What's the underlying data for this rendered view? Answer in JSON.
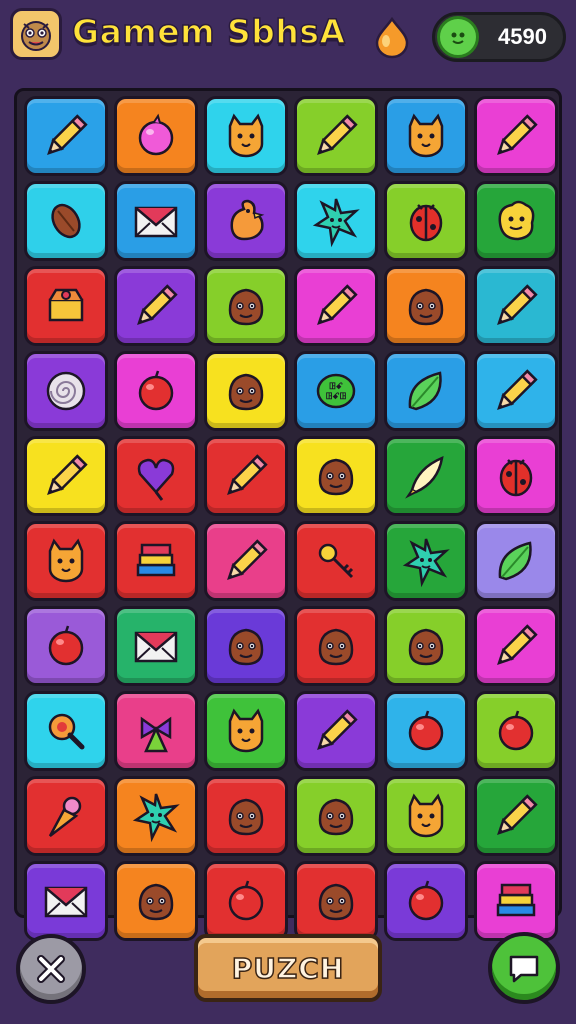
{
  "header": {
    "title": "Gamem SbhsA",
    "coins": "4590"
  },
  "colors": {
    "background": "#3f2c5e",
    "title": "#ffe23a",
    "accent_green": "#4ec23a"
  },
  "board": {
    "rows": [
      [
        {
          "color": "#2aa1e8",
          "icon": "pencil-icon"
        },
        {
          "color": "#f5841f",
          "icon": "bubble-icon"
        },
        {
          "color": "#2fd3ec",
          "icon": "cat-icon"
        },
        {
          "color": "#86cf2a",
          "icon": "pencil-icon"
        },
        {
          "color": "#2a9ee6",
          "icon": "cat-icon"
        },
        {
          "color": "#ea3fd4",
          "icon": "pencil-icon"
        }
      ],
      [
        {
          "color": "#2fd0ea",
          "icon": "nut-icon"
        },
        {
          "color": "#2a9ee6",
          "icon": "envelope-icon"
        },
        {
          "color": "#8a3ad8",
          "icon": "duck-icon"
        },
        {
          "color": "#2fd3ec",
          "icon": "star-icon"
        },
        {
          "color": "#86cf2a",
          "icon": "bug-icon"
        },
        {
          "color": "#26a63a",
          "icon": "blob-icon"
        }
      ],
      [
        {
          "color": "#e23030",
          "icon": "box-icon"
        },
        {
          "color": "#8a3ad8",
          "icon": "pencil-icon"
        },
        {
          "color": "#86cf2a",
          "icon": "monster-icon"
        },
        {
          "color": "#e93fd4",
          "icon": "pencil-icon"
        },
        {
          "color": "#f5841f",
          "icon": "monster-icon"
        },
        {
          "color": "#2ab8d2",
          "icon": "pencil-icon"
        }
      ],
      [
        {
          "color": "#8a3ad8",
          "icon": "swirl-icon"
        },
        {
          "color": "#e93fd4",
          "icon": "ball-icon"
        },
        {
          "color": "#f7e11f",
          "icon": "monster-icon"
        },
        {
          "color": "#2a9ee6",
          "icon": "badge-icon"
        },
        {
          "color": "#2a9ee6",
          "icon": "leaf-icon"
        },
        {
          "color": "#2fb3ea",
          "icon": "pencil-icon"
        }
      ],
      [
        {
          "color": "#f7e11f",
          "icon": "pencil-icon"
        },
        {
          "color": "#e23030",
          "icon": "heart-icon"
        },
        {
          "color": "#e23030",
          "icon": "pencil-icon"
        },
        {
          "color": "#f7e11f",
          "icon": "monster-icon"
        },
        {
          "color": "#26a63a",
          "icon": "rocket-icon"
        },
        {
          "color": "#e93fd4",
          "icon": "bug-icon"
        }
      ],
      [
        {
          "color": "#e23030",
          "icon": "cat-icon"
        },
        {
          "color": "#e23030",
          "icon": "books-icon"
        },
        {
          "color": "#e93f8a",
          "icon": "pencil-icon"
        },
        {
          "color": "#e23030",
          "icon": "key-icon"
        },
        {
          "color": "#26a63a",
          "icon": "star-icon"
        },
        {
          "color": "#9a88ea",
          "icon": "leaf-icon"
        }
      ],
      [
        {
          "color": "#9a5ad8",
          "icon": "ball-icon"
        },
        {
          "color": "#26b36a",
          "icon": "envelope-icon"
        },
        {
          "color": "#6a3ad8",
          "icon": "monster-icon"
        },
        {
          "color": "#e23030",
          "icon": "monster-icon"
        },
        {
          "color": "#86cf2a",
          "icon": "monster-icon"
        },
        {
          "color": "#e93fd4",
          "icon": "pencil-icon"
        }
      ],
      [
        {
          "color": "#2fd3ec",
          "icon": "rattle-icon"
        },
        {
          "color": "#e93f8a",
          "icon": "bow-icon"
        },
        {
          "color": "#3fc23a",
          "icon": "cat-icon"
        },
        {
          "color": "#8a3ad8",
          "icon": "pencil-icon"
        },
        {
          "color": "#2fb3ea",
          "icon": "ball-icon"
        },
        {
          "color": "#86cf2a",
          "icon": "ball-icon"
        }
      ],
      [
        {
          "color": "#e23030",
          "icon": "cone-icon"
        },
        {
          "color": "#f5841f",
          "icon": "star-icon"
        },
        {
          "color": "#e23030",
          "icon": "monster-icon"
        },
        {
          "color": "#86cf2a",
          "icon": "monster-icon"
        },
        {
          "color": "#86cf2a",
          "icon": "cat-icon"
        },
        {
          "color": "#26a63a",
          "icon": "pencil-icon"
        }
      ],
      [
        {
          "color": "#7a3ad8",
          "icon": "envelope-icon"
        },
        {
          "color": "#f5841f",
          "icon": "monster-icon"
        },
        {
          "color": "#e23030",
          "icon": "ball-icon"
        },
        {
          "color": "#e23030",
          "icon": "monster-icon"
        },
        {
          "color": "#7a3ad8",
          "icon": "ball-icon"
        },
        {
          "color": "#e93fd4",
          "icon": "books-icon"
        }
      ]
    ]
  },
  "footer": {
    "puzch_label": "PUZCH",
    "close_icon": "close-icon",
    "chat_icon": "chat-icon"
  }
}
